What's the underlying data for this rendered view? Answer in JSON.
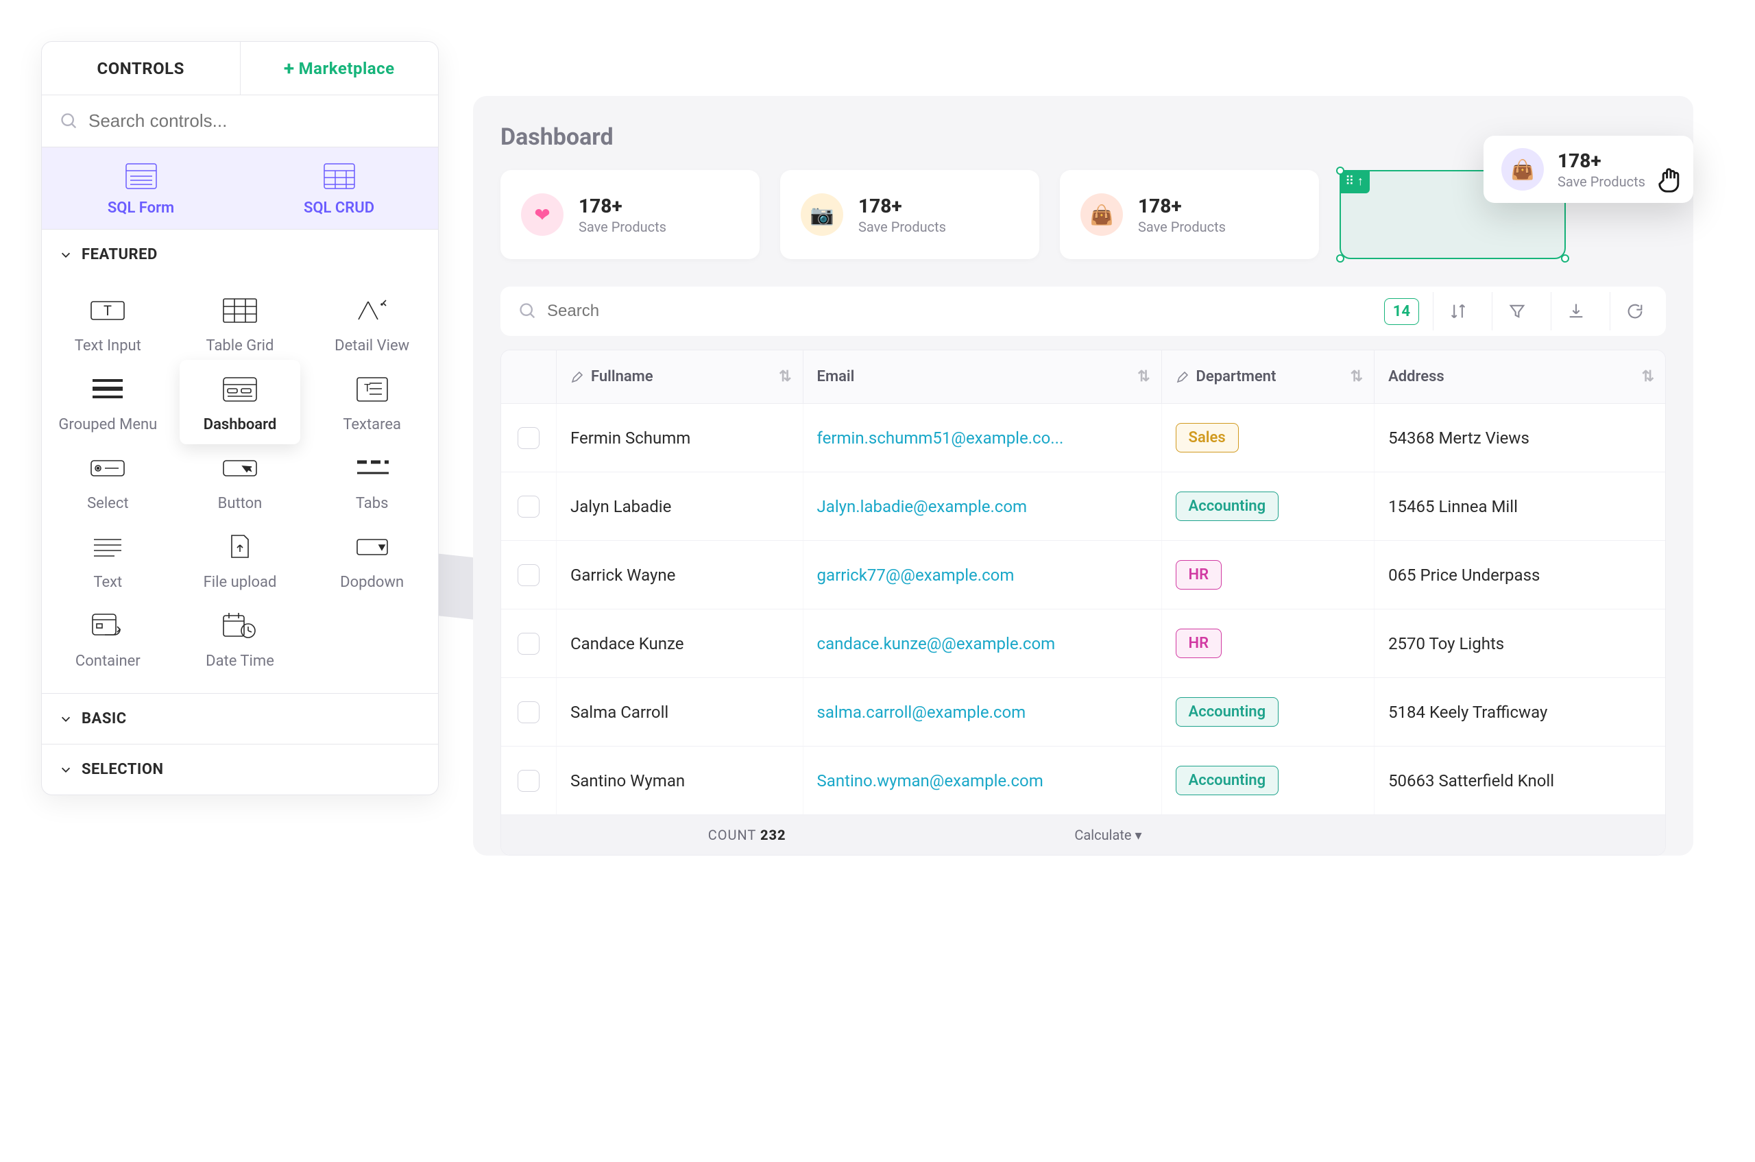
{
  "sidebar": {
    "tabs": {
      "controls": "CONTROLS",
      "marketplace": "Marketplace"
    },
    "search_placeholder": "Search controls...",
    "quick": [
      {
        "id": "sql-form",
        "label": "SQL Form"
      },
      {
        "id": "sql-crud",
        "label": "SQL CRUD"
      }
    ],
    "sections": {
      "featured": "FEATURED",
      "basic": "BASIC",
      "selection": "SELECTION"
    },
    "featured_controls": [
      {
        "id": "text-input",
        "label": "Text Input"
      },
      {
        "id": "table-grid",
        "label": "Table Grid"
      },
      {
        "id": "detail-view",
        "label": "Detail View"
      },
      {
        "id": "grouped-menu",
        "label": "Grouped Menu"
      },
      {
        "id": "dashboard",
        "label": "Dashboard"
      },
      {
        "id": "textarea",
        "label": "Textarea"
      },
      {
        "id": "select",
        "label": "Select"
      },
      {
        "id": "button",
        "label": "Button"
      },
      {
        "id": "tabs",
        "label": "Tabs"
      },
      {
        "id": "text",
        "label": "Text"
      },
      {
        "id": "file-upload",
        "label": "File upload"
      },
      {
        "id": "dropdown",
        "label": "Dopdown"
      },
      {
        "id": "container",
        "label": "Container"
      },
      {
        "id": "date-time",
        "label": "Date Time"
      }
    ]
  },
  "main": {
    "title": "Dashboard",
    "stats": [
      {
        "num": "178+",
        "label": "Save Products",
        "variant": "pink",
        "icon": "❤"
      },
      {
        "num": "178+",
        "label": "Save Products",
        "variant": "yellow",
        "icon": "📷"
      },
      {
        "num": "178+",
        "label": "Save Products",
        "variant": "orange",
        "icon": "👜"
      }
    ],
    "floating": {
      "num": "178+",
      "label": "Save Products",
      "variant": "purple",
      "icon": "👜"
    },
    "table": {
      "search_placeholder": "Search",
      "badge": "14",
      "columns": [
        "Fullname",
        "Email",
        "Department",
        "Address"
      ],
      "rows": [
        {
          "name": "Fermin Schumm",
          "email": "fermin.schumm51@example.co...",
          "dept": "Sales",
          "dept_class": "sales",
          "address": "54368 Mertz Views"
        },
        {
          "name": "Jalyn Labadie",
          "email": "Jalyn.labadie@example.com",
          "dept": "Accounting",
          "dept_class": "accounting",
          "address": "15465 Linnea Mill"
        },
        {
          "name": "Garrick Wayne",
          "email": "garrick77@@example.com",
          "dept": "HR",
          "dept_class": "hr",
          "address": "065 Price Underpass"
        },
        {
          "name": "Candace Kunze",
          "email": "candace.kunze@@example.com",
          "dept": "HR",
          "dept_class": "hr",
          "address": "2570 Toy Lights"
        },
        {
          "name": "Salma Carroll",
          "email": "salma.carroll@example.com",
          "dept": "Accounting",
          "dept_class": "accounting",
          "address": "5184 Keely Trafficway"
        },
        {
          "name": "Santino Wyman",
          "email": "Santino.wyman@example.com",
          "dept": "Accounting",
          "dept_class": "accounting",
          "address": "50663 Satterfield Knoll"
        }
      ],
      "footer": {
        "count_label": "COUNT",
        "count_value": "232",
        "calc": "Calculate ▾"
      }
    }
  }
}
